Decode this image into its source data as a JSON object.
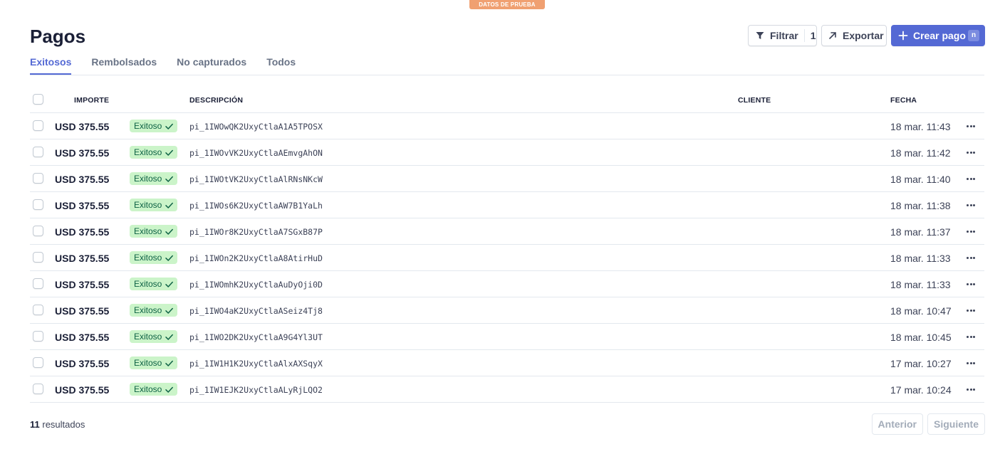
{
  "banner": {
    "label": "DATOS DE PRUEBA"
  },
  "header": {
    "title": "Pagos"
  },
  "toolbar": {
    "filter_label": "Filtrar",
    "filter_count": "1",
    "export_label": "Exportar",
    "create_label": "Crear pago",
    "create_shortcut": "n"
  },
  "tabs": [
    {
      "label": "Exitosos",
      "active": true
    },
    {
      "label": "Rembolsados",
      "active": false
    },
    {
      "label": "No capturados",
      "active": false
    },
    {
      "label": "Todos",
      "active": false
    }
  ],
  "table": {
    "columns": {
      "amount": "IMPORTE",
      "description": "DESCRIPCIÓN",
      "customer": "CLIENTE",
      "date": "FECHA"
    },
    "rows": [
      {
        "amount": "USD 375.55",
        "status": "Exitoso",
        "description": "pi_1IWOwQK2UxyCtlaA1A5TPOSX",
        "customer": "",
        "date": "18 mar. 11:43"
      },
      {
        "amount": "USD 375.55",
        "status": "Exitoso",
        "description": "pi_1IWOvVK2UxyCtlaAEmvgAhON",
        "customer": "",
        "date": "18 mar. 11:42"
      },
      {
        "amount": "USD 375.55",
        "status": "Exitoso",
        "description": "pi_1IWOtVK2UxyCtlaAlRNsNKcW",
        "customer": "",
        "date": "18 mar. 11:40"
      },
      {
        "amount": "USD 375.55",
        "status": "Exitoso",
        "description": "pi_1IWOs6K2UxyCtlaAW7B1YaLh",
        "customer": "",
        "date": "18 mar. 11:38"
      },
      {
        "amount": "USD 375.55",
        "status": "Exitoso",
        "description": "pi_1IWOr8K2UxyCtlaA7SGxB87P",
        "customer": "",
        "date": "18 mar. 11:37"
      },
      {
        "amount": "USD 375.55",
        "status": "Exitoso",
        "description": "pi_1IWOn2K2UxyCtlaA8AtirHuD",
        "customer": "",
        "date": "18 mar. 11:33"
      },
      {
        "amount": "USD 375.55",
        "status": "Exitoso",
        "description": "pi_1IWOmhK2UxyCtlaAuDyOji0D",
        "customer": "",
        "date": "18 mar. 11:33"
      },
      {
        "amount": "USD 375.55",
        "status": "Exitoso",
        "description": "pi_1IWO4aK2UxyCtlaASeiz4Tj8",
        "customer": "",
        "date": "18 mar. 10:47"
      },
      {
        "amount": "USD 375.55",
        "status": "Exitoso",
        "description": "pi_1IWO2DK2UxyCtlaA9G4Yl3UT",
        "customer": "",
        "date": "18 mar. 10:45"
      },
      {
        "amount": "USD 375.55",
        "status": "Exitoso",
        "description": "pi_1IW1H1K2UxyCtlaAlxAXSqyX",
        "customer": "",
        "date": "17 mar. 10:27"
      },
      {
        "amount": "USD 375.55",
        "status": "Exitoso",
        "description": "pi_1IW1EJK2UxyCtlaALyRjLQO2",
        "customer": "",
        "date": "17 mar. 10:24"
      }
    ]
  },
  "footer": {
    "results_count": "11",
    "results_label": "resultados",
    "prev_label": "Anterior",
    "next_label": "Siguiente"
  },
  "colors": {
    "accent": "#5469d4",
    "success_bg": "#cbf4c9",
    "success_text": "#0e6245",
    "test_badge": "#f0a071"
  }
}
